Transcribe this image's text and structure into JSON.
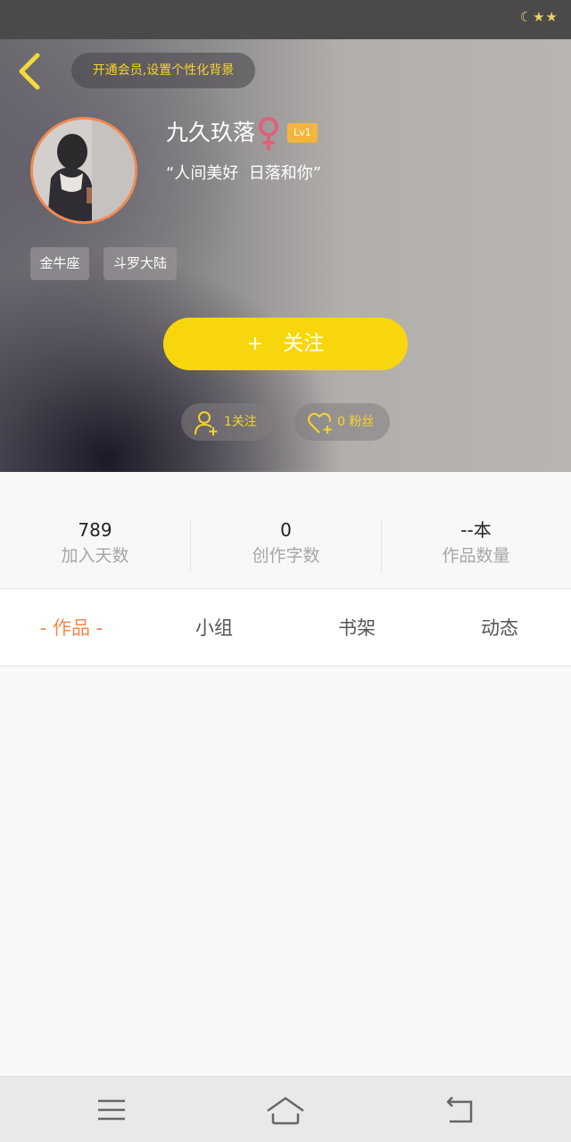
{
  "status_bar": {
    "indicator_text": "☾★★"
  },
  "header": {
    "vip_prompt": "开通会员,设置个性化背景",
    "username": "九久玖落",
    "gender": "female",
    "level": "Lv1",
    "signature": "“人间美好  日落和你”",
    "tags": [
      "金牛座",
      "斗罗大陆"
    ],
    "follow_button": {
      "plus": "+",
      "label": "关注"
    },
    "following": "1关注",
    "fans": "0 粉丝"
  },
  "stats": [
    {
      "value": "789",
      "label": "加入天数"
    },
    {
      "value": "0",
      "label": "创作字数"
    },
    {
      "value": "--本",
      "label": "作品数量"
    }
  ],
  "tabs": [
    {
      "label": "- 作品 -",
      "active": true
    },
    {
      "label": "小组",
      "active": false
    },
    {
      "label": "书架",
      "active": false
    },
    {
      "label": "动态",
      "active": false
    }
  ],
  "colors": {
    "accent_yellow": "#f8d60d",
    "accent_orange": "#f0884d",
    "gender_pink": "#e0607a",
    "level_badge": "#f3b53b"
  },
  "icons": {
    "back": "chevron-left-icon",
    "gender": "female-icon",
    "following": "person-plus-icon",
    "fans": "heart-plus-icon",
    "nav_menu": "menu-icon",
    "nav_home": "home-icon",
    "nav_back": "back-arrow-icon"
  }
}
